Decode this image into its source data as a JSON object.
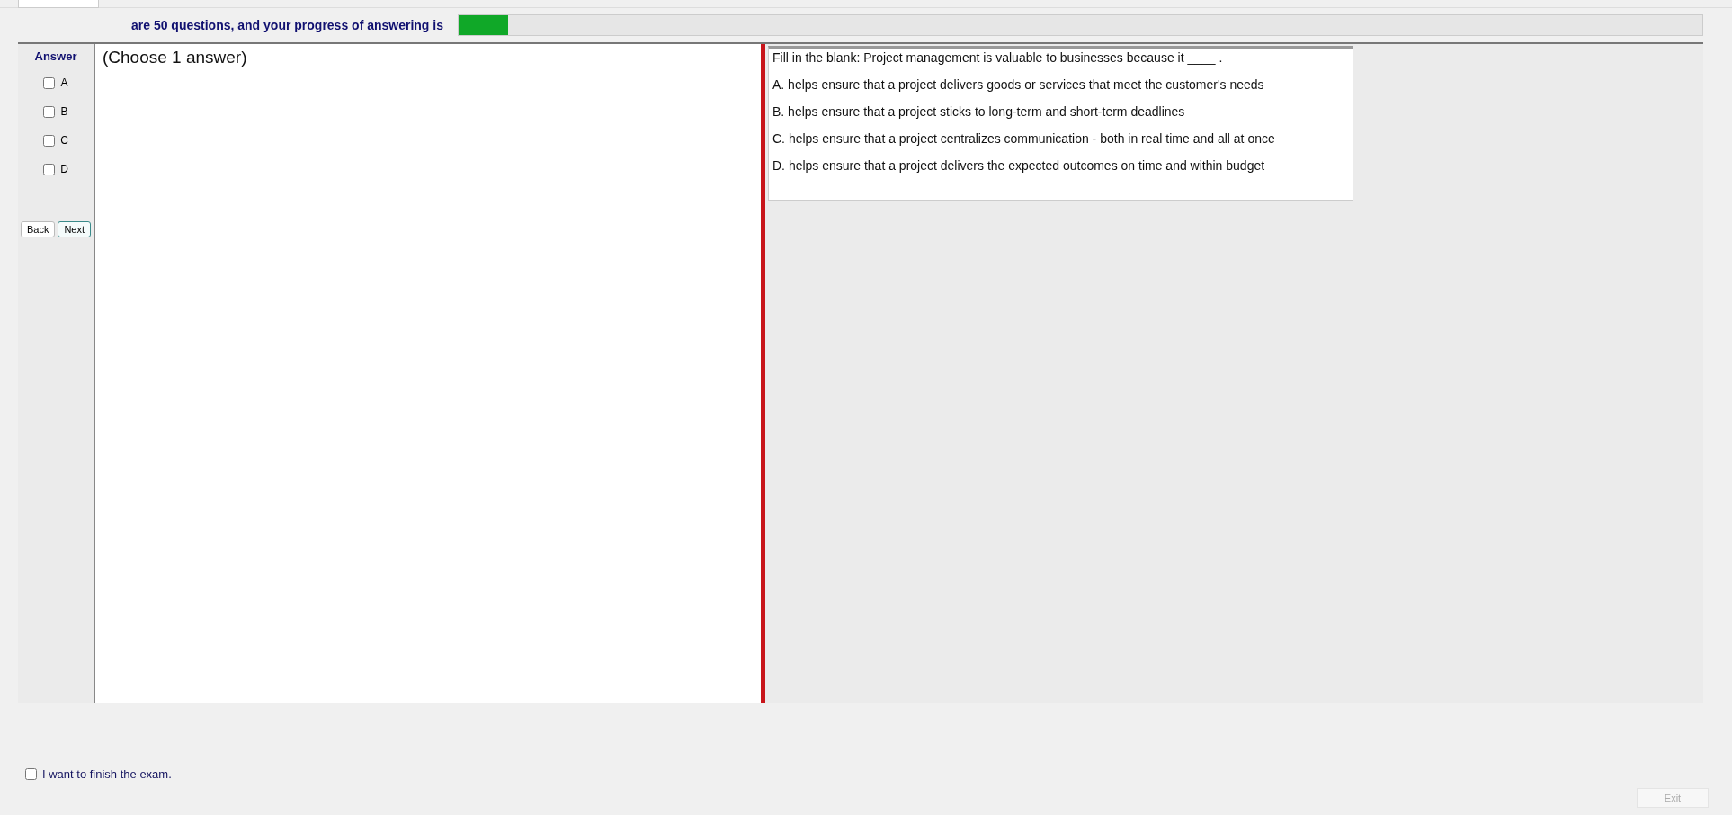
{
  "header": {
    "progress_text": "are 50 questions, and your progress of answering is",
    "progress": {
      "level": 0.04
    }
  },
  "answer_panel": {
    "title": "Answer",
    "options": [
      {
        "label": "A",
        "checked": false
      },
      {
        "label": "B",
        "checked": false
      },
      {
        "label": "C",
        "checked": false
      },
      {
        "label": "D",
        "checked": false
      }
    ],
    "buttons": [
      {
        "label": "Back",
        "selected": false
      },
      {
        "label": "Next",
        "selected": true
      }
    ]
  },
  "instruction": "(Choose 1 answer)",
  "question": {
    "text": "Fill in the blank: Project management is valuable to businesses because it ____ .",
    "choices": [
      "A.  helps ensure that a project delivers goods or services that meet the customer's needs",
      "B.  helps ensure that a project sticks to long-term and short-term deadlines",
      "C.   helps ensure that a project centralizes communication - both in real time and all at once",
      "D.  helps ensure that a project delivers the expected outcomes on time and within budget"
    ]
  },
  "finish": {
    "label": "I want to finish the exam.",
    "checked": false
  },
  "exit_button": {
    "label": "Exit",
    "disabled": true
  }
}
